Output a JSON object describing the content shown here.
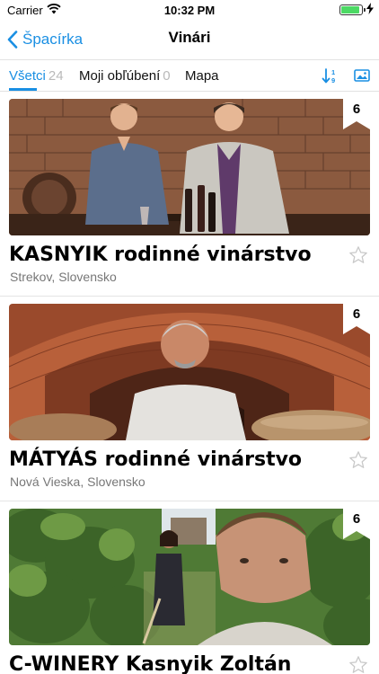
{
  "status_bar": {
    "carrier": "Carrier",
    "time": "10:32 PM",
    "battery_level": 0.9
  },
  "nav": {
    "back_label": "Špacírka",
    "title": "Vinári"
  },
  "tabs": [
    {
      "label": "Všetci",
      "count": "24",
      "active": true
    },
    {
      "label": "Moji obľúbení",
      "count": "0",
      "active": false
    },
    {
      "label": "Mapa",
      "count": "",
      "active": false
    }
  ],
  "toolbar_icons": [
    "sort-icon",
    "image-view-icon"
  ],
  "wineries": [
    {
      "name": "KASNYIK rodinné vinárstvo",
      "location": "Strekov, Slovensko",
      "wine_count": "6",
      "favorite": false
    },
    {
      "name": "MÁTYÁS rodinné vinárstvo",
      "location": "Nová Vieska, Slovensko",
      "wine_count": "6",
      "favorite": false
    },
    {
      "name": "C-WINERY Kasnyik Zoltán",
      "location": "",
      "wine_count": "6",
      "favorite": false
    }
  ],
  "colors": {
    "accent": "#1a8fe3",
    "count_gray": "#b9b9b9",
    "subtitle_gray": "#777777"
  }
}
